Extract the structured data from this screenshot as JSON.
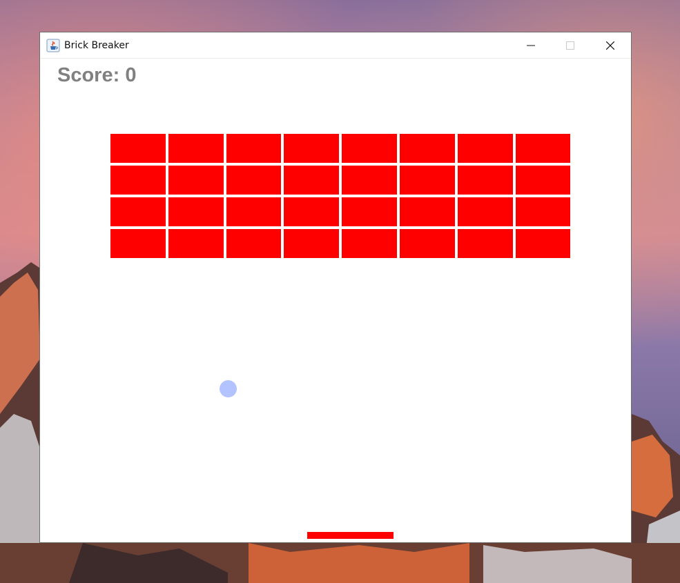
{
  "window": {
    "title": "Brick Breaker"
  },
  "game": {
    "score_text": "Score: 0",
    "brick_rows": 4,
    "brick_columns": 8,
    "colors": {
      "brick": "#ff0000",
      "paddle": "#ff0000",
      "ball": "#b3c3ff",
      "score": "#808080",
      "background": "#ffffff"
    }
  },
  "icons": {
    "app": "java-cup-icon",
    "minimize": "minimize-icon",
    "maximize": "maximize-icon",
    "close": "close-icon"
  }
}
